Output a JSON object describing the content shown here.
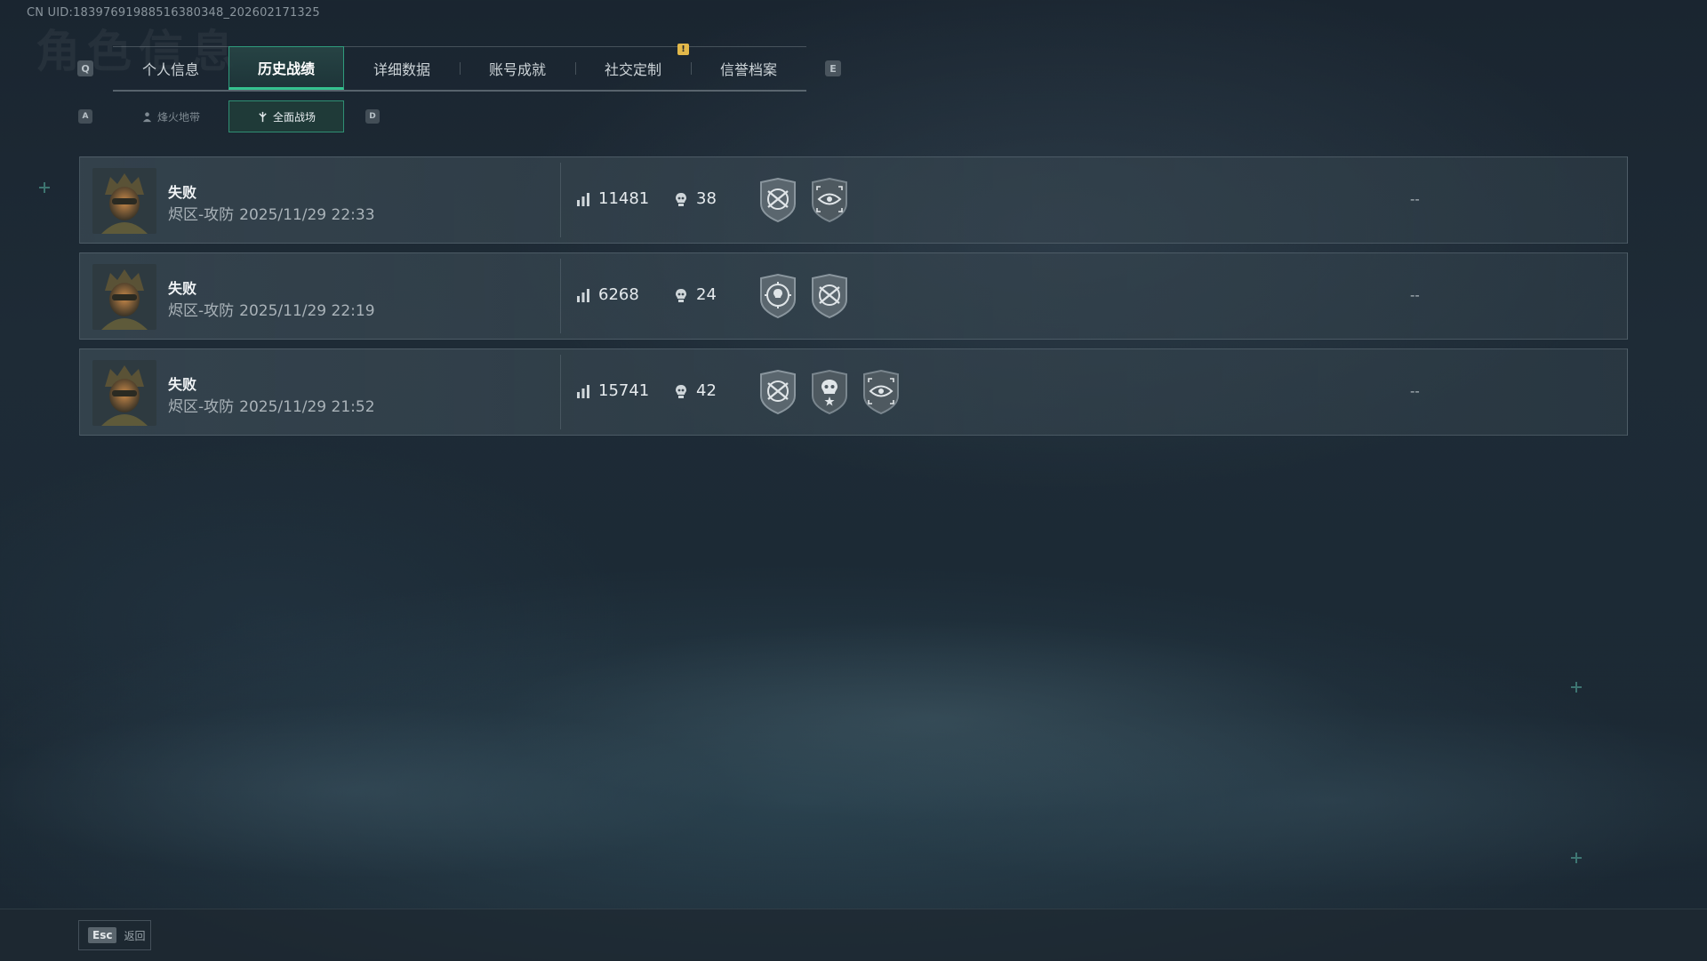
{
  "uid_text": "CN UID:18397691988516380348_202602171325",
  "background_title": "角色信息",
  "keys": {
    "prev_tab": "Q",
    "next_tab": "E",
    "prev_sub": "A",
    "next_sub": "D"
  },
  "tabs": [
    {
      "label": "个人信息",
      "active": false
    },
    {
      "label": "历史战绩",
      "active": true
    },
    {
      "label": "详细数据",
      "active": false
    },
    {
      "label": "账号成就",
      "active": false
    },
    {
      "label": "社交定制",
      "active": false,
      "alert": "!"
    },
    {
      "label": "信誉档案",
      "active": false
    }
  ],
  "subtabs": [
    {
      "label": "烽火地带",
      "icon": "operator-icon",
      "active": false
    },
    {
      "label": "全面战场",
      "icon": "battlefield-icon",
      "active": true
    }
  ],
  "records": [
    {
      "result": "失败",
      "mode": "烬区-攻防",
      "datetime": "2025/11/29 22:33",
      "score": "11481",
      "kills": "38",
      "badges": [
        "crossed-rifles-badge",
        "eye-target-badge"
      ],
      "extra": "--"
    },
    {
      "result": "失败",
      "mode": "烬区-攻防",
      "datetime": "2025/11/29 22:19",
      "score": "6268",
      "kills": "24",
      "badges": [
        "skull-target-badge",
        "crossed-rifles-badge"
      ],
      "extra": "--"
    },
    {
      "result": "失败",
      "mode": "烬区-攻防",
      "datetime": "2025/11/29 21:52",
      "score": "15741",
      "kills": "42",
      "badges": [
        "crossed-rifles-badge",
        "skull-star-badge",
        "eye-target-badge"
      ],
      "extra": "--"
    }
  ],
  "footer": {
    "esc_key": "Esc",
    "back_label": "返回"
  },
  "colors": {
    "accent": "#35c28f",
    "alert": "#e2b84a",
    "panel": "#3c4b55"
  }
}
